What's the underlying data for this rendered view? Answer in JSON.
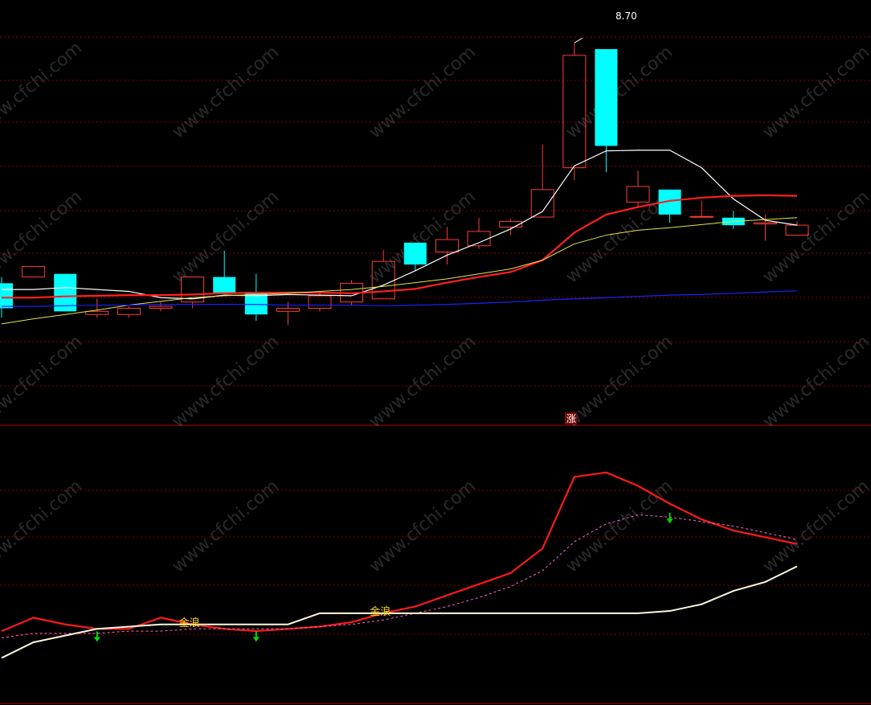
{
  "colors": {
    "background": "#000000",
    "up_candle": "#ff3b3b",
    "down_candle": "#00ffff",
    "grid": "#8b0000",
    "ma5": "#ffffff",
    "ma10": "#ff2020",
    "ma20": "#e5e54a",
    "ma60": "#2020ff",
    "ind_red": "#ff1a1a",
    "ind_white": "#fff8dc",
    "ind_dotted": "#ff66cc",
    "arrow": "#00dd00",
    "gold_text": "#ffd700",
    "separator": "#b00000"
  },
  "watermark": "www.cfchi.com",
  "chart_data": [
    {
      "type": "candlestick",
      "title": "",
      "max_label": "8.70",
      "marker_label": "涨",
      "ylim": [
        3.4,
        9.0
      ],
      "grid": true,
      "candles": [
        {
          "o": 4.85,
          "h": 4.95,
          "l": 4.3,
          "c": 4.45
        },
        {
          "o": 4.95,
          "h": 5.12,
          "l": 4.95,
          "c": 5.12
        },
        {
          "o": 5.0,
          "h": 5.0,
          "l": 4.4,
          "c": 4.4
        },
        {
          "o": 4.35,
          "h": 4.6,
          "l": 4.3,
          "c": 4.4
        },
        {
          "o": 4.35,
          "h": 4.48,
          "l": 4.3,
          "c": 4.45
        },
        {
          "o": 4.45,
          "h": 4.55,
          "l": 4.4,
          "c": 4.48
        },
        {
          "o": 4.55,
          "h": 4.95,
          "l": 4.45,
          "c": 4.95
        },
        {
          "o": 4.95,
          "h": 5.37,
          "l": 4.7,
          "c": 4.7
        },
        {
          "o": 4.7,
          "h": 5.0,
          "l": 4.25,
          "c": 4.35
        },
        {
          "o": 4.4,
          "h": 4.55,
          "l": 4.18,
          "c": 4.45
        },
        {
          "o": 4.45,
          "h": 4.7,
          "l": 4.4,
          "c": 4.65
        },
        {
          "o": 4.55,
          "h": 4.9,
          "l": 4.5,
          "c": 4.85
        },
        {
          "o": 4.6,
          "h": 5.38,
          "l": 4.6,
          "c": 5.2
        },
        {
          "o": 5.5,
          "h": 5.5,
          "l": 5.05,
          "c": 5.15
        },
        {
          "o": 5.35,
          "h": 5.75,
          "l": 5.15,
          "c": 5.55
        },
        {
          "o": 5.45,
          "h": 5.9,
          "l": 5.4,
          "c": 5.68
        },
        {
          "o": 5.75,
          "h": 5.88,
          "l": 5.62,
          "c": 5.84
        },
        {
          "o": 5.91,
          "h": 7.07,
          "l": 5.91,
          "c": 6.35
        },
        {
          "o": 6.7,
          "h": 8.7,
          "l": 6.5,
          "c": 8.5
        },
        {
          "o": 8.6,
          "h": 8.6,
          "l": 6.63,
          "c": 7.05
        },
        {
          "o": 6.15,
          "h": 6.65,
          "l": 6.07,
          "c": 6.4
        },
        {
          "o": 6.35,
          "h": 6.35,
          "l": 5.82,
          "c": 5.95
        },
        {
          "o": 5.92,
          "h": 6.17,
          "l": 5.92,
          "c": 5.92
        },
        {
          "o": 5.9,
          "h": 6.01,
          "l": 5.72,
          "c": 5.78
        },
        {
          "o": 5.8,
          "h": 5.95,
          "l": 5.53,
          "c": 5.82
        },
        {
          "o": 5.62,
          "h": 5.84,
          "l": 5.62,
          "c": 5.78
        }
      ],
      "series": [
        {
          "key": "ma5",
          "values": [
            4.75,
            4.75,
            4.78,
            4.75,
            4.72,
            4.62,
            4.6,
            4.66,
            4.65,
            4.67,
            4.66,
            4.65,
            4.82,
            5.05,
            5.3,
            5.5,
            5.72,
            6.0,
            6.73,
            6.97,
            6.98,
            6.98,
            6.7,
            6.2,
            5.86,
            5.78
          ]
        },
        {
          "key": "ma10",
          "values": [
            4.62,
            4.62,
            4.64,
            4.65,
            4.66,
            4.66,
            4.67,
            4.69,
            4.7,
            4.7,
            4.7,
            4.69,
            4.72,
            4.76,
            4.86,
            4.95,
            5.03,
            5.22,
            5.66,
            5.95,
            6.07,
            6.17,
            6.22,
            6.25,
            6.26,
            6.25
          ]
        },
        {
          "key": "ma20",
          "values": [
            4.2,
            4.28,
            4.35,
            4.42,
            4.5,
            4.56,
            4.62,
            4.65,
            4.67,
            4.69,
            4.72,
            4.75,
            4.8,
            4.86,
            4.92,
            5.0,
            5.08,
            5.22,
            5.48,
            5.62,
            5.7,
            5.74,
            5.79,
            5.84,
            5.87,
            5.9
          ]
        },
        {
          "key": "ma60",
          "values": [
            4.48,
            4.48,
            4.49,
            4.5,
            4.5,
            4.51,
            4.51,
            4.51,
            4.51,
            4.5,
            4.5,
            4.5,
            4.49,
            4.5,
            4.51,
            4.53,
            4.55,
            4.58,
            4.6,
            4.62,
            4.64,
            4.66,
            4.67,
            4.69,
            4.71,
            4.73
          ]
        }
      ]
    },
    {
      "type": "line",
      "title": "",
      "ylim": [
        0,
        100
      ],
      "grid": true,
      "series": [
        {
          "key": "ind_red",
          "values": [
            14,
            20,
            17,
            15,
            15,
            20,
            17,
            15,
            14,
            15,
            16,
            18,
            22,
            25,
            30,
            35,
            40,
            51,
            83,
            85,
            79,
            71,
            64,
            59,
            56,
            53
          ]
        },
        {
          "key": "ind_dotted",
          "values": [
            11,
            13,
            13,
            13,
            14,
            14,
            15,
            15,
            15,
            15,
            16,
            17,
            19,
            22,
            25,
            29,
            34,
            41,
            54,
            62,
            66,
            65,
            63,
            61,
            58,
            55
          ]
        },
        {
          "key": "ind_white",
          "values": [
            2,
            9,
            12,
            15,
            16,
            17,
            17,
            17,
            17,
            17,
            22,
            22,
            22,
            22,
            22,
            22,
            22,
            22,
            22,
            22,
            22,
            23,
            26,
            32,
            36,
            43
          ]
        }
      ],
      "annotations": [
        {
          "text": "金浪",
          "index": 6,
          "value": 18
        },
        {
          "text": "金浪",
          "index": 12,
          "value": 23
        }
      ],
      "sell_arrows": [
        {
          "index": 3,
          "value": 11
        },
        {
          "index": 8,
          "value": 11
        },
        {
          "index": 21,
          "value": 64
        }
      ]
    }
  ]
}
